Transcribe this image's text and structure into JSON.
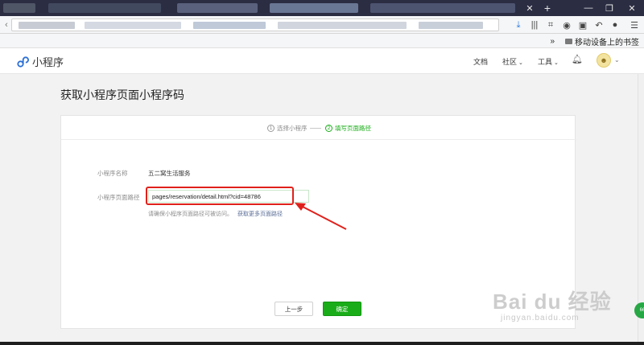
{
  "browser": {
    "bookmark_label": "移动设备上的书签",
    "window_controls": [
      "—",
      "❐",
      "✕"
    ],
    "new_tab": "+"
  },
  "header": {
    "logo_text": "小程序",
    "nav": {
      "docs": "文档",
      "community": "社区",
      "tools": "工具"
    }
  },
  "page": {
    "title": "获取小程序页面小程序码",
    "steps": [
      {
        "num": "1",
        "label": "选择小程序",
        "state": "done"
      },
      {
        "num": "2",
        "label": "填写页面路径",
        "state": "active"
      }
    ],
    "form": {
      "name_label": "小程序名称",
      "name_value": "五二窝生活服务",
      "path_label": "小程序页面路径",
      "path_value": "pages/reservation/detail.html?cid=48786",
      "hint": "请确保小程序页面路径可被访问。",
      "hint_link": "获取更多页面路径"
    },
    "buttons": {
      "prev": "上一步",
      "confirm": "确定"
    }
  },
  "watermark": {
    "main": "Bai du 经验",
    "sub": "jingyan.baidu.com"
  },
  "colors": {
    "accent": "#1aad19",
    "highlight": "#e0211b",
    "link": "#576b95"
  }
}
